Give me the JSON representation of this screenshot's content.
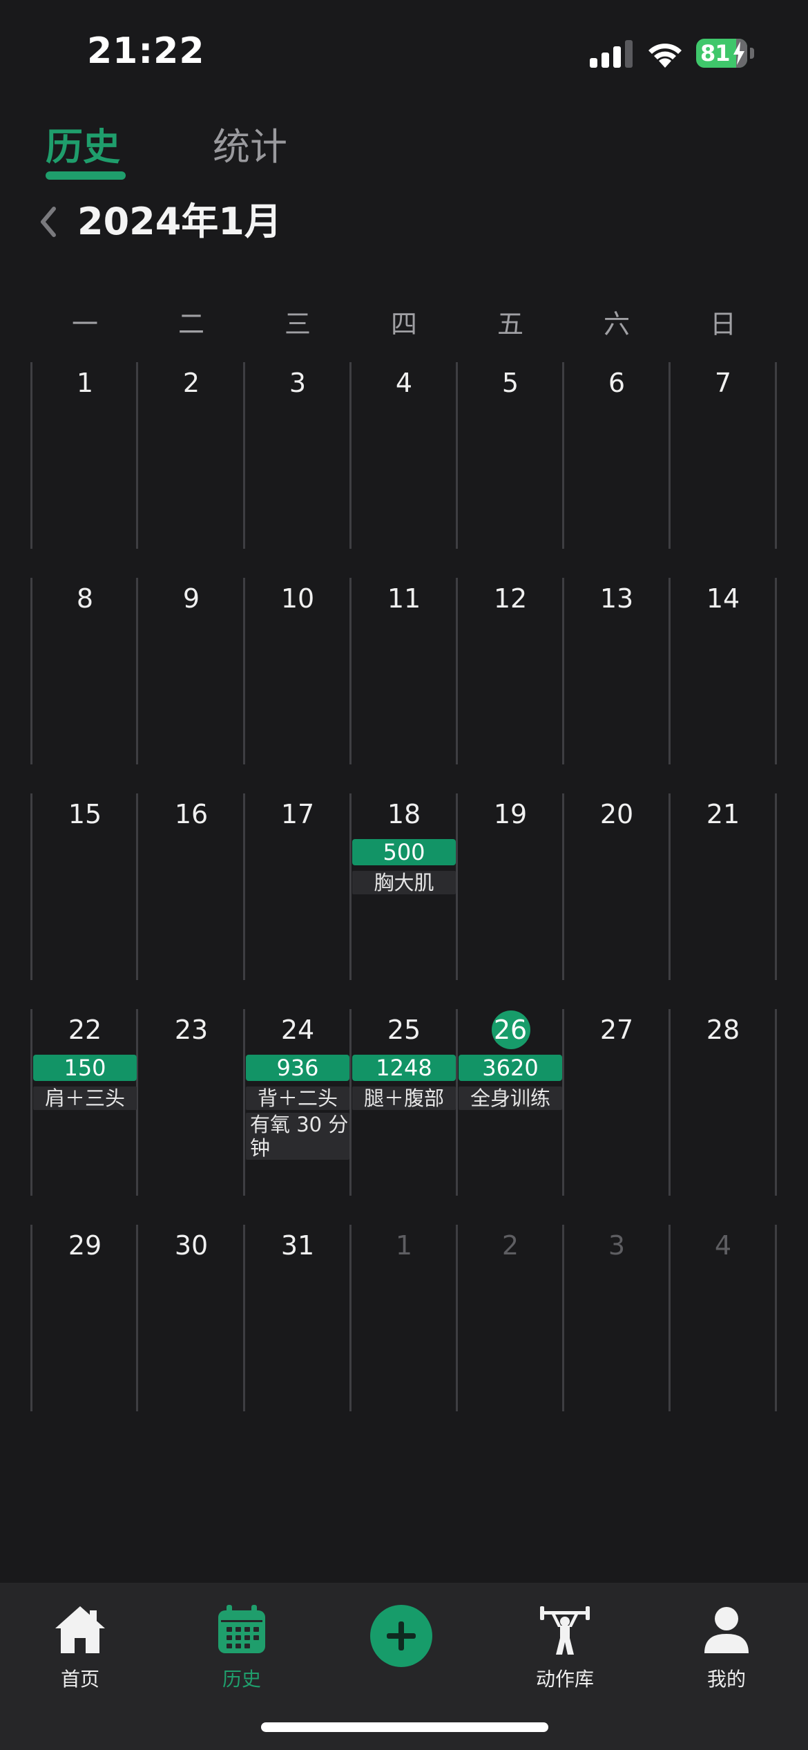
{
  "status_bar": {
    "time": "21:22",
    "battery": "81"
  },
  "tabs": [
    {
      "label": "历史",
      "active": true
    },
    {
      "label": "统计",
      "active": false
    }
  ],
  "month_title": "2024年1月",
  "weekdays": [
    "一",
    "二",
    "三",
    "四",
    "五",
    "六",
    "日"
  ],
  "weeks": [
    [
      {
        "day": "1"
      },
      {
        "day": "2"
      },
      {
        "day": "3"
      },
      {
        "day": "4"
      },
      {
        "day": "5"
      },
      {
        "day": "6"
      },
      {
        "day": "7"
      }
    ],
    [
      {
        "day": "8"
      },
      {
        "day": "9"
      },
      {
        "day": "10"
      },
      {
        "day": "11"
      },
      {
        "day": "12"
      },
      {
        "day": "13"
      },
      {
        "day": "14"
      }
    ],
    [
      {
        "day": "15"
      },
      {
        "day": "16"
      },
      {
        "day": "17"
      },
      {
        "day": "18",
        "volume": "500",
        "labels": [
          "胸大肌"
        ]
      },
      {
        "day": "19"
      },
      {
        "day": "20"
      },
      {
        "day": "21"
      }
    ],
    [
      {
        "day": "22",
        "volume": "150",
        "labels": [
          "肩＋三头"
        ]
      },
      {
        "day": "23"
      },
      {
        "day": "24",
        "volume": "936",
        "labels": [
          "背＋二头",
          "有氧 30 分钟"
        ]
      },
      {
        "day": "25",
        "volume": "1248",
        "labels": [
          "腿＋腹部"
        ]
      },
      {
        "day": "26",
        "today": true,
        "volume": "3620",
        "labels": [
          "全身训练"
        ]
      },
      {
        "day": "27"
      },
      {
        "day": "28"
      }
    ],
    [
      {
        "day": "29"
      },
      {
        "day": "30"
      },
      {
        "day": "31"
      },
      {
        "day": "1",
        "other_month": true
      },
      {
        "day": "2",
        "other_month": true
      },
      {
        "day": "3",
        "other_month": true
      },
      {
        "day": "4",
        "other_month": true
      }
    ]
  ],
  "colors": {
    "accent": "#1f9e6c",
    "badge": "#129466",
    "background": "#19191b",
    "nav_background": "#262628"
  },
  "bottom_nav": [
    {
      "label": "首页",
      "icon": "home-icon",
      "active": false
    },
    {
      "label": "历史",
      "icon": "calendar-icon",
      "active": true
    },
    {
      "label": "",
      "icon": "plus-icon",
      "active": false
    },
    {
      "label": "动作库",
      "icon": "weightlifter-icon",
      "active": false
    },
    {
      "label": "我的",
      "icon": "person-icon",
      "active": false
    }
  ]
}
